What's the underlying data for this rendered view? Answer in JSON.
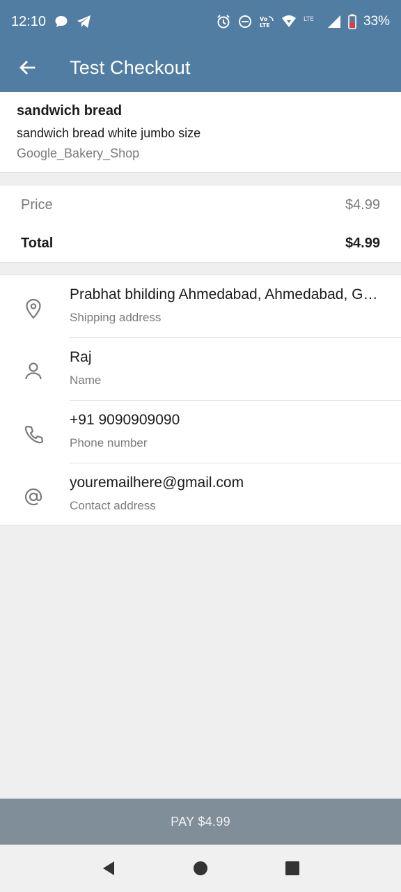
{
  "status_bar": {
    "time": "12:10",
    "battery": "33%",
    "icons": [
      "chat-bubble-icon",
      "telegram-icon",
      "alarm-icon",
      "do-not-disturb-icon",
      "volte-icon",
      "wifi-icon",
      "lte-icon",
      "signal-icon",
      "battery-icon"
    ],
    "volte_text": "Vo LTE",
    "lte_text": "LTE"
  },
  "app_bar": {
    "title": "Test Checkout",
    "back_icon": "back-arrow-icon"
  },
  "product": {
    "name": "sandwich bread",
    "description": "sandwich bread white jumbo size",
    "shop": "Google_Bakery_Shop"
  },
  "prices": {
    "price_label": "Price",
    "price_value": "$4.99",
    "total_label": "Total",
    "total_value": "$4.99"
  },
  "info": {
    "rows": [
      {
        "value": "Prabhat bhilding Ahmedabad, Ahmedabad, Gujarat",
        "label": "Shipping address",
        "icon": "location-pin-icon"
      },
      {
        "value": "Raj",
        "label": "Name",
        "icon": "person-icon"
      },
      {
        "value": "+91 9090909090",
        "label": "Phone number",
        "icon": "phone-icon"
      },
      {
        "value": "youremailhere@gmail.com",
        "label": "Contact address",
        "icon": "at-sign-icon"
      }
    ]
  },
  "pay_button": {
    "label": "PAY $4.99"
  },
  "nav_bar": {
    "icons": [
      "nav-back-icon",
      "nav-home-icon",
      "nav-recents-icon"
    ]
  },
  "colors": {
    "header": "#527da3",
    "pay_button": "#808e9a",
    "background": "#efefef"
  }
}
